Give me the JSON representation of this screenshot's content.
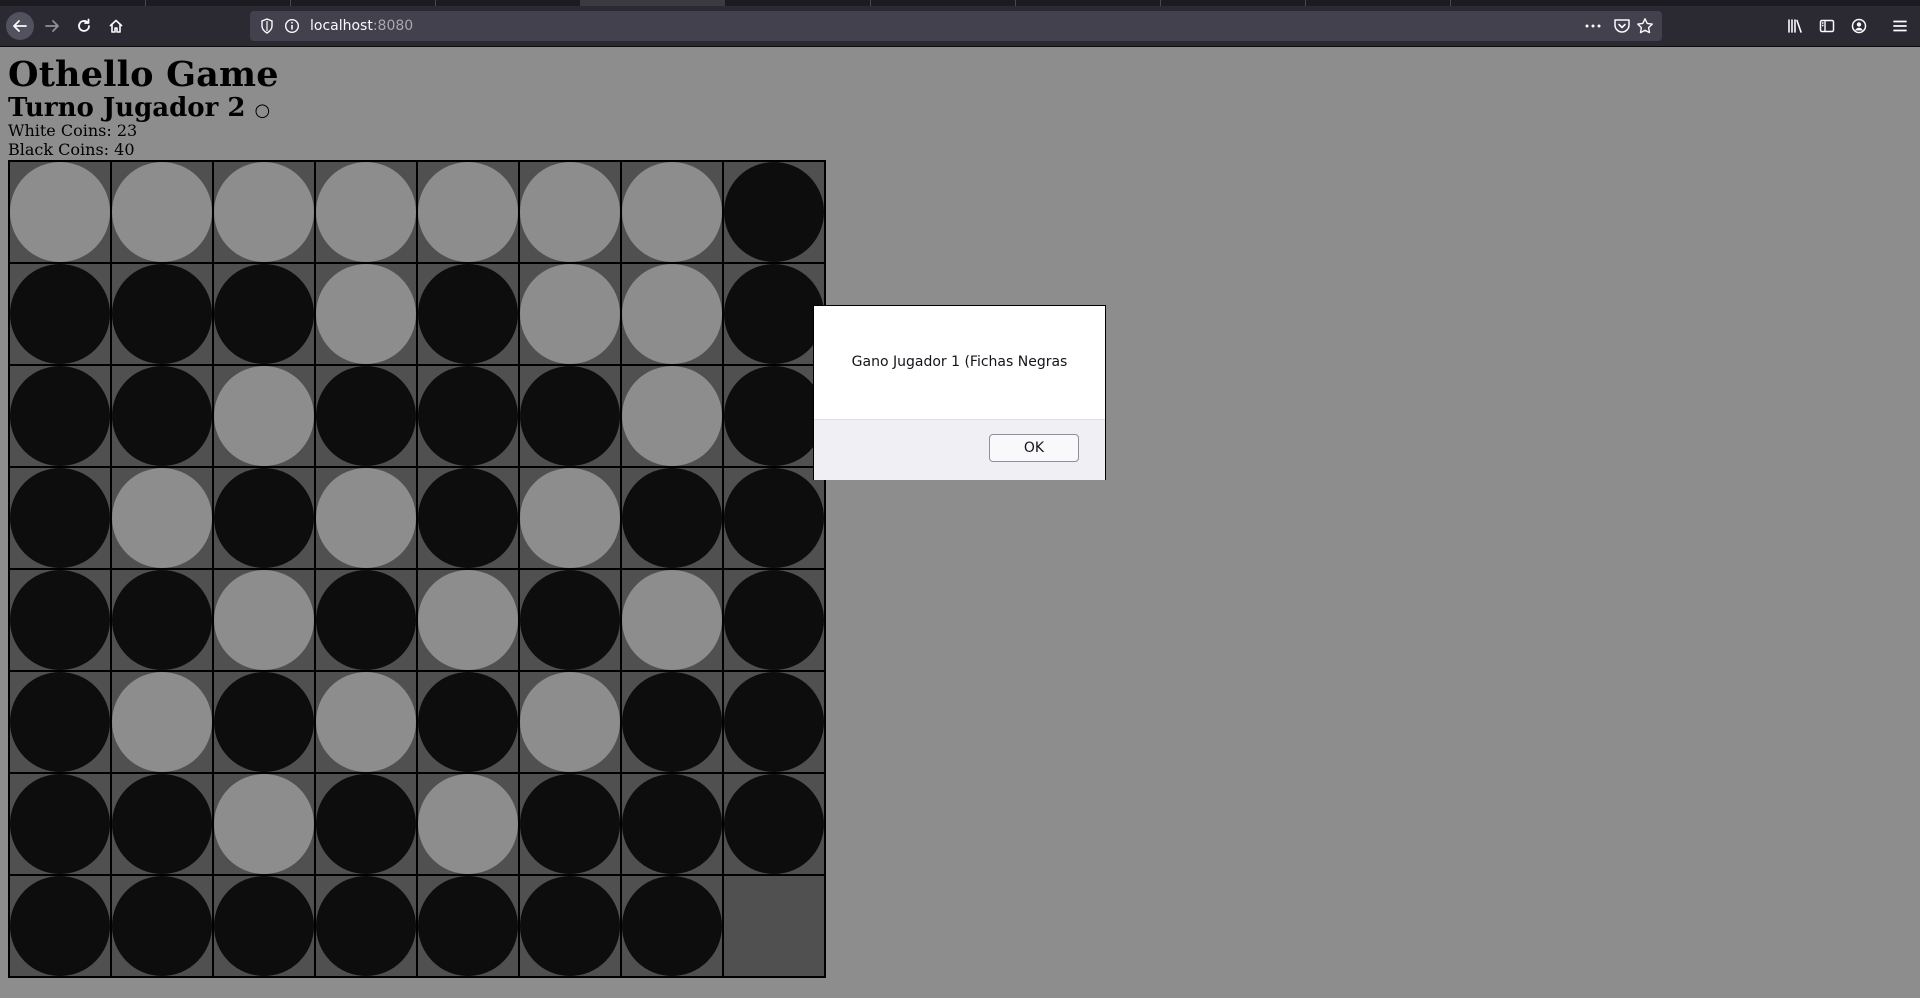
{
  "browser": {
    "url_host": "localhost",
    "url_port": ":8080"
  },
  "page": {
    "title": "Othello Game",
    "turn_label": "Turno Jugador 2",
    "turn_symbol": "○",
    "white_coins_text": "White Coins: 23",
    "black_coins_text": "Black Coins: 40"
  },
  "board": {
    "rows": [
      [
        "w",
        "w",
        "w",
        "w",
        "w",
        "w",
        "w",
        "b"
      ],
      [
        "b",
        "b",
        "b",
        "w",
        "b",
        "w",
        "w",
        "b"
      ],
      [
        "b",
        "b",
        "w",
        "b",
        "b",
        "b",
        "w",
        "b"
      ],
      [
        "b",
        "w",
        "b",
        "w",
        "b",
        "w",
        "b",
        "b"
      ],
      [
        "b",
        "b",
        "w",
        "b",
        "w",
        "b",
        "w",
        "b"
      ],
      [
        "b",
        "w",
        "b",
        "w",
        "b",
        "w",
        "b",
        "b"
      ],
      [
        "b",
        "b",
        "w",
        "b",
        "w",
        "b",
        "b",
        "b"
      ],
      [
        "b",
        "b",
        "b",
        "b",
        "b",
        "b",
        "b",
        ""
      ]
    ],
    "colors": {
      "black_disc": "#0d0d0d",
      "white_disc": "#8d8d8d",
      "cell": "#505050"
    }
  },
  "dialog": {
    "message": "Gano Jugador 1 (Fichas Negras",
    "ok_label": "OK"
  }
}
